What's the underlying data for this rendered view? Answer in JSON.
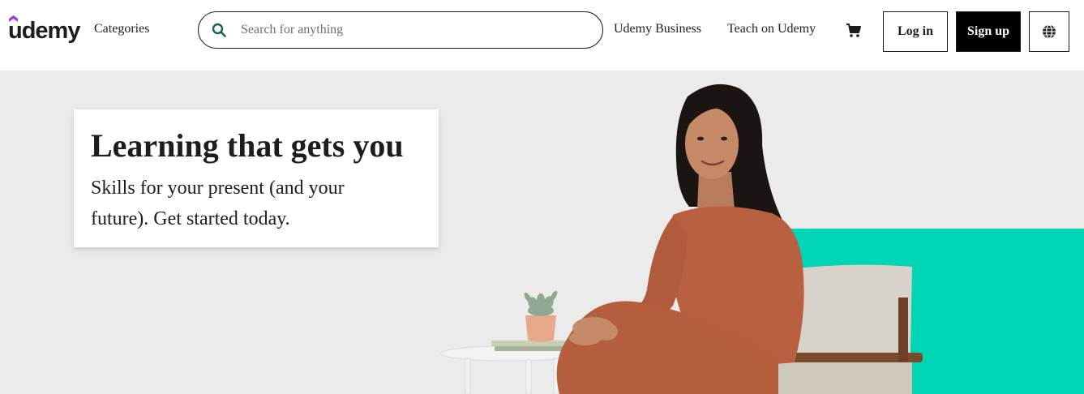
{
  "header": {
    "logo_text": "udemy",
    "categories_label": "Categories",
    "search": {
      "placeholder": "Search for anything",
      "value": ""
    },
    "nav_links": {
      "business": "Udemy Business",
      "teach": "Teach on Udemy"
    },
    "buttons": {
      "login": "Log in",
      "signup": "Sign up"
    },
    "icons": {
      "search": "search-icon",
      "cart": "cart-icon",
      "language": "globe-icon"
    }
  },
  "hero": {
    "title": "Learning that gets you",
    "subtitle": "Skills for your present (and your future). Get started today."
  },
  "colors": {
    "brand_purple": "#a435f0",
    "search_icon_green": "#1e6055",
    "hero_background": "#ebebeb",
    "teal_accent": "#00d5b5",
    "text": "#1c1d1f"
  }
}
